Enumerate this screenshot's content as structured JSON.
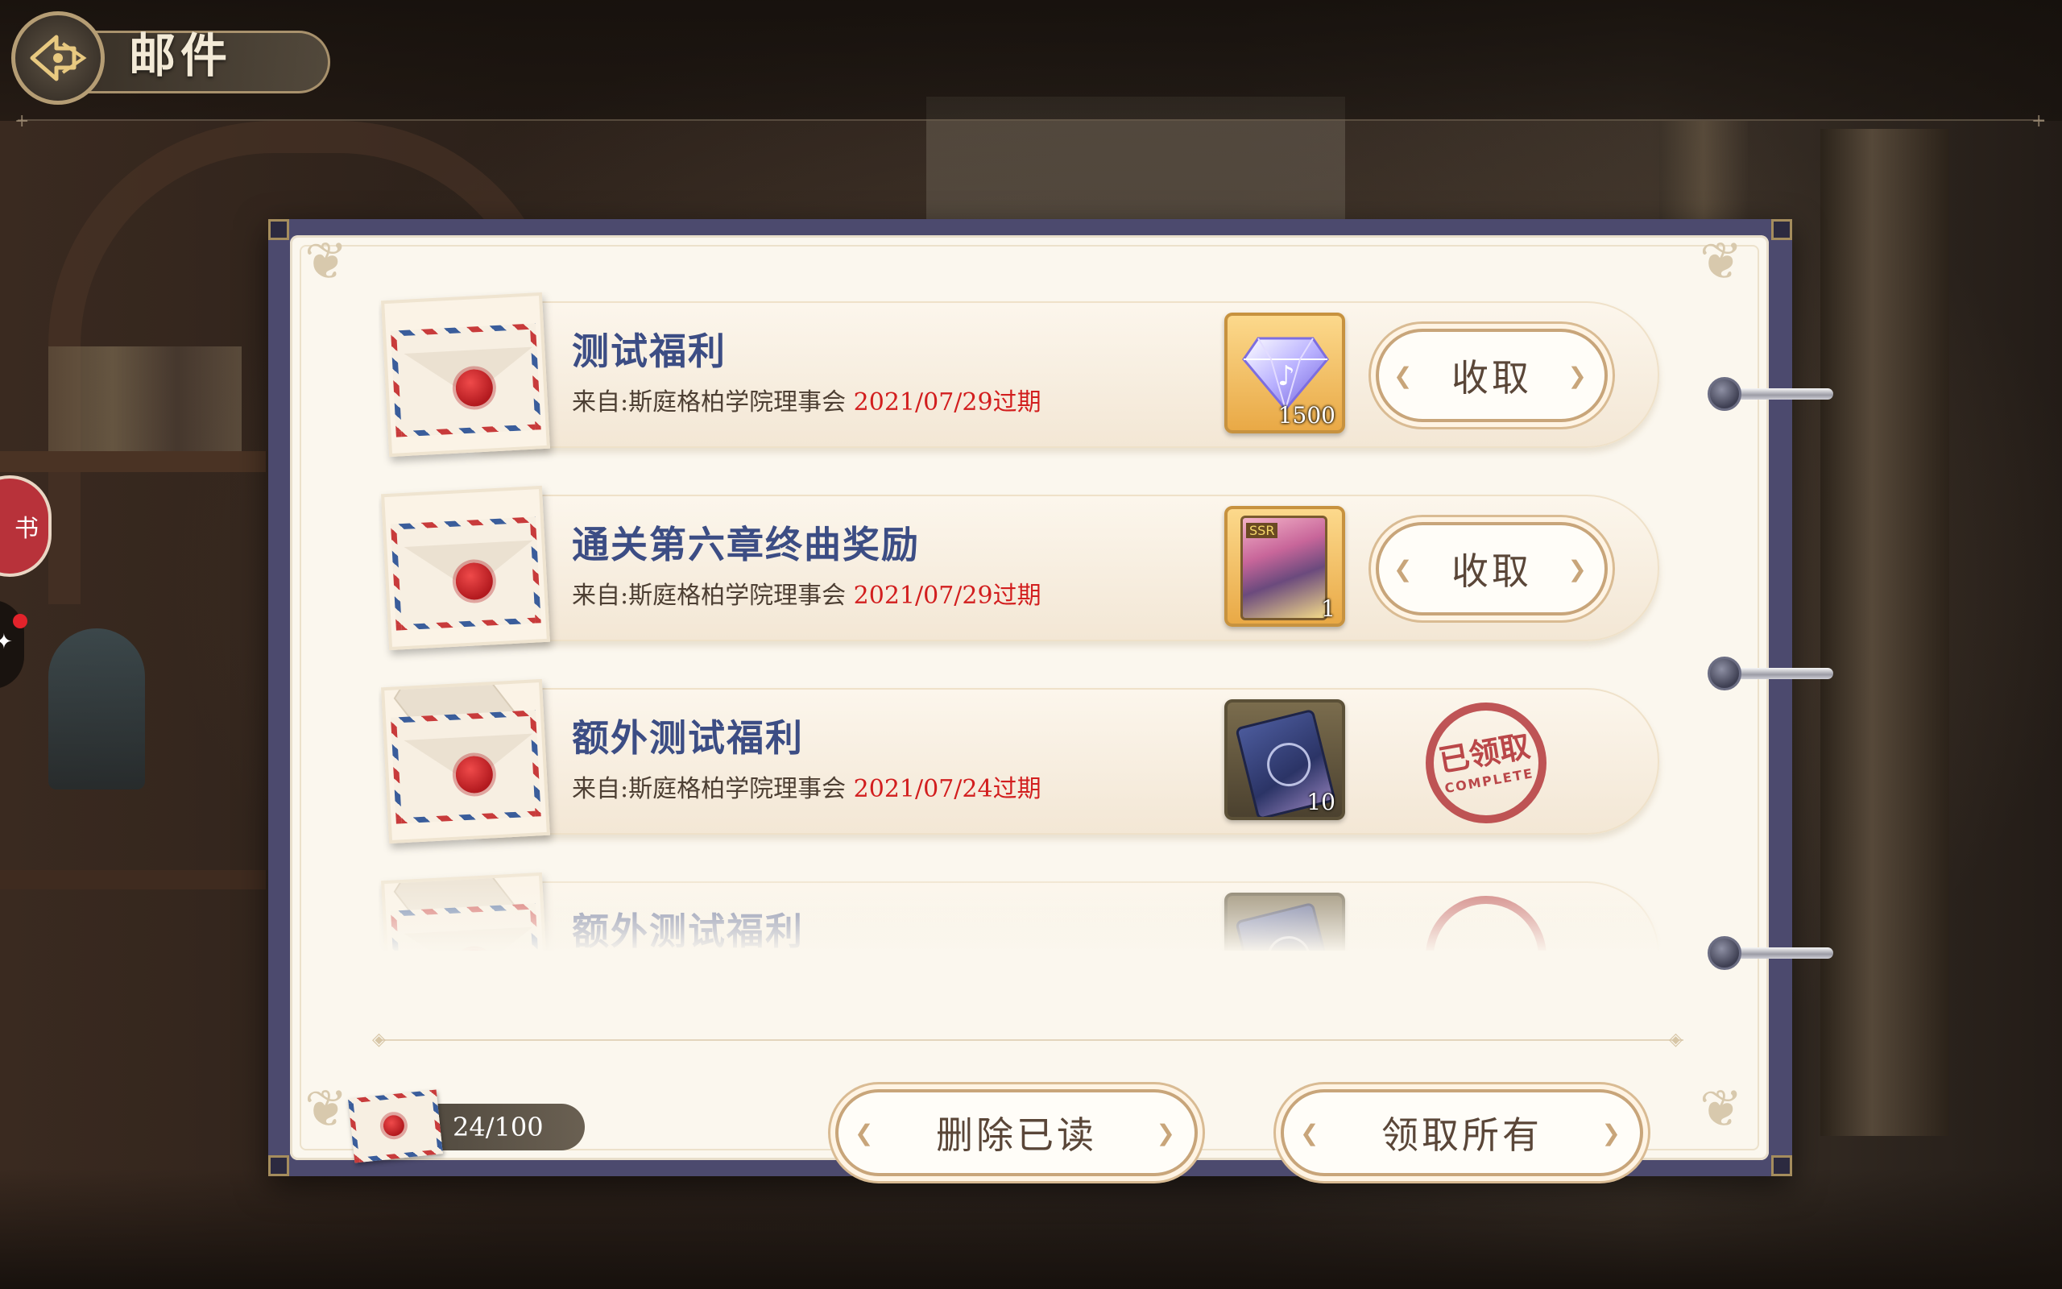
{
  "header": {
    "title": "邮件"
  },
  "side": {
    "badge_label": "书"
  },
  "mails": [
    {
      "title": "测试福利",
      "from": "来自:斯庭格柏学院理事会",
      "expires": "2021/07/29过期",
      "reward": {
        "icon": "diamond-gem-icon",
        "count": "1500"
      },
      "action": "收取",
      "claimed": false
    },
    {
      "title": "通关第六章终曲奖励",
      "from": "来自:斯庭格柏学院理事会",
      "expires": "2021/07/29过期",
      "reward": {
        "icon": "character-card-icon",
        "tag": "SSR",
        "count": "1"
      },
      "action": "收取",
      "claimed": false
    },
    {
      "title": "额外测试福利",
      "from": "来自:斯庭格柏学院理事会",
      "expires": "2021/07/24过期",
      "reward": {
        "icon": "ticket-icon",
        "count": "10"
      },
      "stamp": {
        "main": "已领取",
        "sub": "COMPLETE"
      },
      "claimed": true
    },
    {
      "title": "额外测试福利",
      "claimed": true
    }
  ],
  "footer": {
    "mail_count": "24/100",
    "delete_read_label": "删除已读",
    "claim_all_label": "领取所有"
  },
  "colors": {
    "title_blue": "#3c4d84",
    "expiry_red": "#d21e1e",
    "binder": "#4c4a6e",
    "stamp_red": "#b4383c"
  }
}
